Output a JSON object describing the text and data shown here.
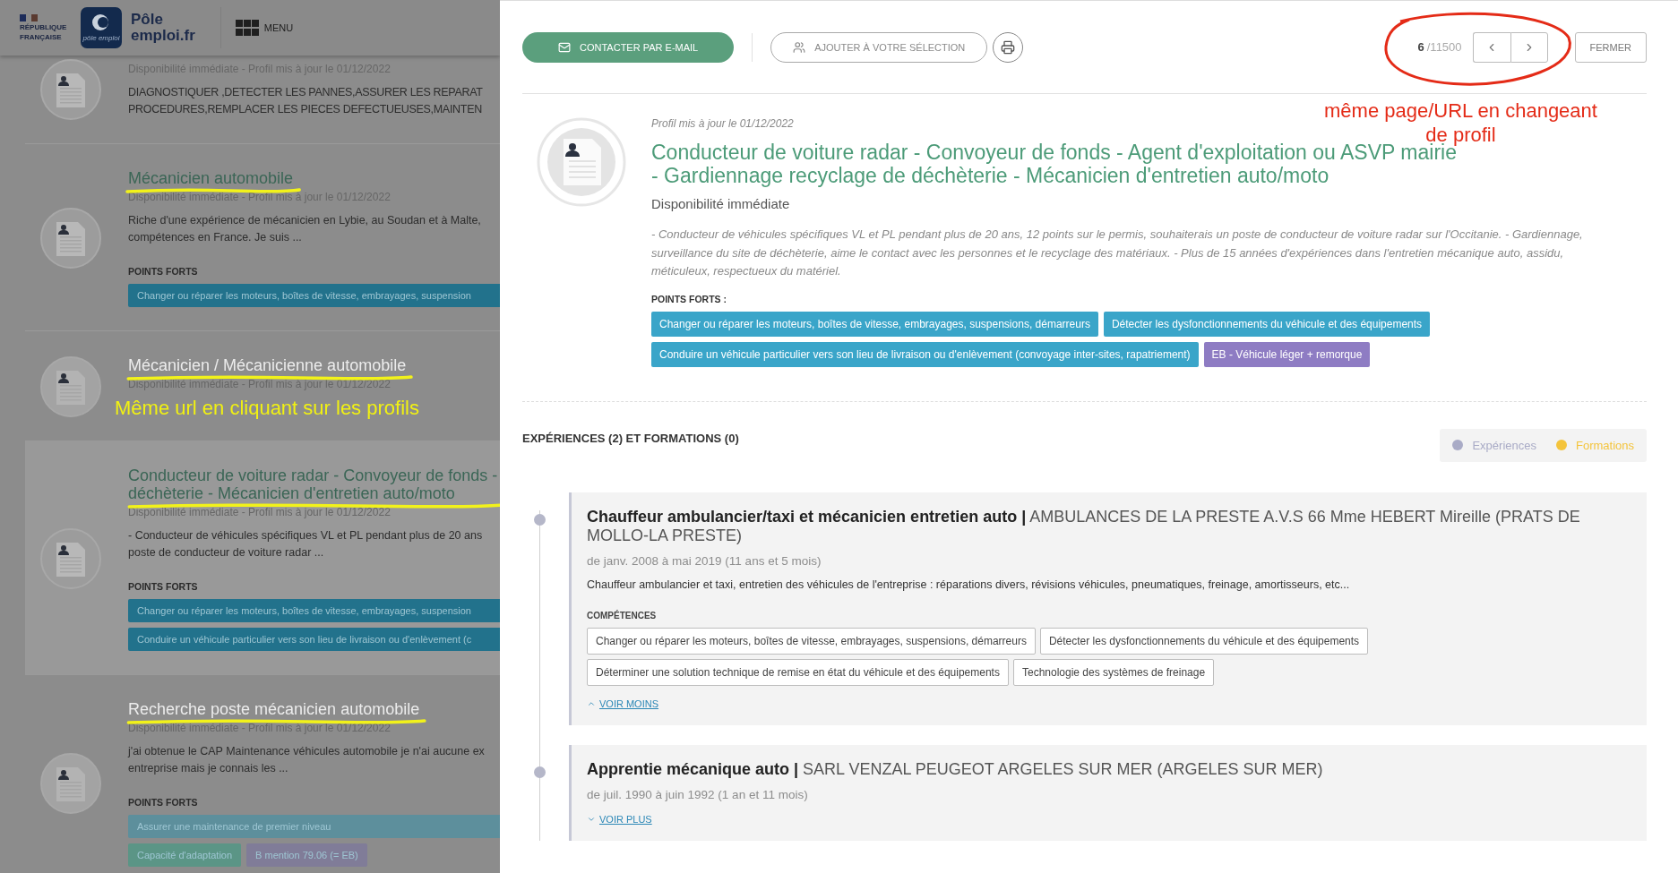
{
  "header": {
    "republic_lines": [
      "RÉPUBLIQUE",
      "FRANÇAISE"
    ],
    "logo_caption": "pôle emploi",
    "brand_lines": [
      "Pôle",
      "emploi.fr"
    ],
    "menu": "MENU"
  },
  "results": [
    {
      "selected": false,
      "faded": false,
      "meta": "Disponibilité immédiate -  Profil mis à jour le 01/12/2022",
      "desc_lines": [
        "DIAGNOSTIQUER ,DETECTER LES PANNES,ASSURER LES REPARAT",
        "PROCEDURES,REMPLACER LES PIECES DEFECTUEUSES,MAINTEN"
      ]
    },
    {
      "selected": false,
      "faded": false,
      "underlined": true,
      "title_lines": [
        "Mécanicien automobile"
      ],
      "meta": "Disponibilité immédiate -  Profil mis à jour le 01/12/2022",
      "desc_lines": [
        "Riche d'une expérience de mécanicien en Lybie, au Soudan et à Malte,",
        "compétences en France. Je suis ..."
      ],
      "points_label": "POINTS FORTS",
      "points": [
        {
          "label": "Changer ou réparer les moteurs, boîtes de vitesse, embrayages, suspension",
          "color": "#22728c"
        }
      ]
    },
    {
      "selected": false,
      "faded": true,
      "underlined": true,
      "title_lines": [
        "Mécanicien / Mécanicienne automobile"
      ],
      "meta": "Disponibilité immédiate -  Profil mis à jour le 01/12/2022"
    },
    {
      "selected": true,
      "faded": false,
      "underlined": true,
      "title_lines": [
        "Conducteur de voiture radar - Convoyeur de fonds -",
        "déchèterie - Mécanicien d'entretien auto/moto"
      ],
      "meta": "Disponibilité immédiate -  Profil mis à jour le 01/12/2022",
      "desc_lines": [
        "- Conducteur de véhicules spécifiques VL et PL pendant plus de 20 ans",
        "poste de conducteur de voiture radar ..."
      ],
      "points_label": "POINTS FORTS",
      "points": [
        {
          "label": "Changer ou réparer les moteurs, boîtes de vitesse, embrayages, suspension",
          "color": "#22728c"
        },
        {
          "label": "Conduire un véhicule particulier vers son lieu de livraison ou d'enlèvement (c",
          "color": "#22728c"
        }
      ]
    },
    {
      "selected": false,
      "faded": true,
      "underlined": true,
      "title_lines": [
        "Recherche poste mécanicien automobile"
      ],
      "meta": "Disponibilité immédiate -  Profil mis à jour le 01/12/2022",
      "desc_lines": [
        "j'ai obtenue le CAP Maintenance véhicules automobile je n'ai aucune ex",
        "entreprise mais je connais les ..."
      ],
      "points_label": "POINTS FORTS",
      "points": [
        {
          "label": "Assurer une maintenance de premier niveau",
          "color": "#5d8f9c"
        },
        {
          "label": "Capacité d'adaptation",
          "color": "#5b9586"
        },
        {
          "label": "B mention 79.06 (= EB)",
          "color": "#807c98"
        }
      ]
    }
  ],
  "annotations": {
    "left_note": "Même url en cliquant sur les profils",
    "right_note_lines": [
      "même page/URL en changeant",
      "de profil"
    ]
  },
  "detail": {
    "toolbar": {
      "contact": "CONTACTER PAR E-MAIL",
      "add": "AJOUTER À VOTRE SÉLECTION",
      "counter_current": "6",
      "counter_total": "/11500",
      "close": "FERMER"
    },
    "profile": {
      "updated": "Profil mis à jour le 01/12/2022",
      "title": "Conducteur de voiture radar - Convoyeur de fonds - Agent d'exploitation ou ASVP mairie - Gardiennage recyclage de déchèterie - Mécanicien d'entretien auto/moto",
      "availability": "Disponibilité immédiate",
      "summary": " - Conducteur de véhicules spécifiques VL et PL pendant plus de 20 ans, 12 points sur le permis, souhaiterais un poste de conducteur de voiture radar sur l'Occitanie. - Gardiennage, surveillance du site de déchèterie, aime le contact avec les personnes et le recyclage des matériaux. - Plus de 15 années d'expériences dans l'entretien mécanique auto, assidu, méticuleux, respectueux du matériel.",
      "strengths_label": "POINTS FORTS :",
      "strengths": [
        {
          "label": "Changer ou réparer les moteurs, boîtes de vitesse, embrayages, suspensions, démarreurs",
          "color": "#3aa5c9"
        },
        {
          "label": "Détecter les dysfonctionnements du véhicule et des équipements",
          "color": "#3aa5c9"
        },
        {
          "label": "Conduire un véhicule particulier vers son lieu de livraison ou d'enlèvement (convoyage inter-sites, rapatriement)",
          "color": "#3aa5c9"
        },
        {
          "label": "EB - Véhicule léger + remorque",
          "color": "#8e7cc3"
        }
      ]
    },
    "experiences": {
      "heading": "EXPÉRIENCES (2) ET FORMATIONS (0)",
      "legend": [
        {
          "label": "Expériences",
          "color": "#a9abc6"
        },
        {
          "label": "Formations",
          "color": "#f4c43c"
        }
      ],
      "items": [
        {
          "heading": "**Chauffeur ambulancier/taxi et mécanicien entretien auto |** AMBULANCES DE LA PRESTE A.V.S 66 Mme HEBERT Mireille (PRATS DE MOLLO-LA PRESTE)",
          "dates": "de janv. 2008 à mai 2019 (11 ans et 5 mois)",
          "description": "Chauffeur ambulancier et taxi, entretien des véhicules de l'entreprise : réparations divers, révisions véhicules, pneumatiques, freinage, amortisseurs, etc...",
          "skills_label": "COMPÉTENCES",
          "skills": [
            "Changer ou réparer les moteurs, boîtes de vitesse, embrayages, suspensions, démarreurs",
            "Détecter les dysfonctionnements du véhicule et des équipements",
            "Déterminer une solution technique de remise en état du véhicule et des équipements",
            "Technologie des systèmes de freinage"
          ],
          "toggle": "VOIR MOINS",
          "expanded": true
        },
        {
          "heading": "**Apprentie mécanique auto |** SARL VENZAL PEUGEOT ARGELES SUR MER (ARGELES SUR MER)",
          "dates": "de juil. 1990 à juin 1992 (1 an et 11 mois)",
          "toggle": "VOIR PLUS",
          "expanded": false
        }
      ]
    }
  }
}
